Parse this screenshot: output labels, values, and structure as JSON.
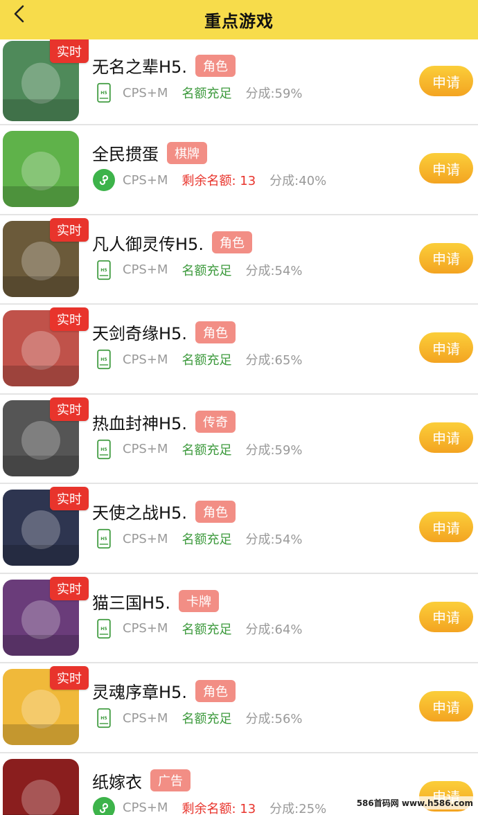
{
  "header": {
    "title": "重点游戏"
  },
  "live_label": "实时",
  "apply_label": "申请",
  "games": [
    {
      "name": "无名之辈H5.",
      "tag": "角色",
      "live": true,
      "type": "h5",
      "cps": "CPS+M",
      "quota": "名额充足",
      "quota_ok": true,
      "share": "分成:59%",
      "thumb_color": "#4f8a5a"
    },
    {
      "name": "全民掼蛋",
      "tag": "棋牌",
      "live": false,
      "type": "mini",
      "cps": "CPS+M",
      "quota": "剩余名额: 13",
      "quota_ok": false,
      "share": "分成:40%",
      "thumb_color": "#5fb24a"
    },
    {
      "name": "凡人御灵传H5.",
      "tag": "角色",
      "live": true,
      "type": "h5",
      "cps": "CPS+M",
      "quota": "名额充足",
      "quota_ok": true,
      "share": "分成:54%",
      "thumb_color": "#6b5a3a"
    },
    {
      "name": "天剑奇缘H5.",
      "tag": "角色",
      "live": true,
      "type": "h5",
      "cps": "CPS+M",
      "quota": "名额充足",
      "quota_ok": true,
      "share": "分成:65%",
      "thumb_color": "#c0524a"
    },
    {
      "name": "热血封神H5.",
      "tag": "传奇",
      "live": true,
      "type": "h5",
      "cps": "CPS+M",
      "quota": "名额充足",
      "quota_ok": true,
      "share": "分成:59%",
      "thumb_color": "#555555"
    },
    {
      "name": "天使之战H5.",
      "tag": "角色",
      "live": true,
      "type": "h5",
      "cps": "CPS+M",
      "quota": "名额充足",
      "quota_ok": true,
      "share": "分成:54%",
      "thumb_color": "#2e3550"
    },
    {
      "name": "猫三国H5.",
      "tag": "卡牌",
      "live": true,
      "type": "h5",
      "cps": "CPS+M",
      "quota": "名额充足",
      "quota_ok": true,
      "share": "分成:64%",
      "thumb_color": "#6a3c7a"
    },
    {
      "name": "灵魂序章H5.",
      "tag": "角色",
      "live": true,
      "type": "h5",
      "cps": "CPS+M",
      "quota": "名额充足",
      "quota_ok": true,
      "share": "分成:56%",
      "thumb_color": "#f0b93a"
    },
    {
      "name": "纸嫁衣",
      "tag": "广告",
      "live": false,
      "type": "mini",
      "cps": "CPS+M",
      "quota": "剩余名额: 13",
      "quota_ok": false,
      "share": "分成:25%",
      "thumb_color": "#8a1e1e"
    }
  ],
  "watermark": "586首码网 www.h586.com"
}
